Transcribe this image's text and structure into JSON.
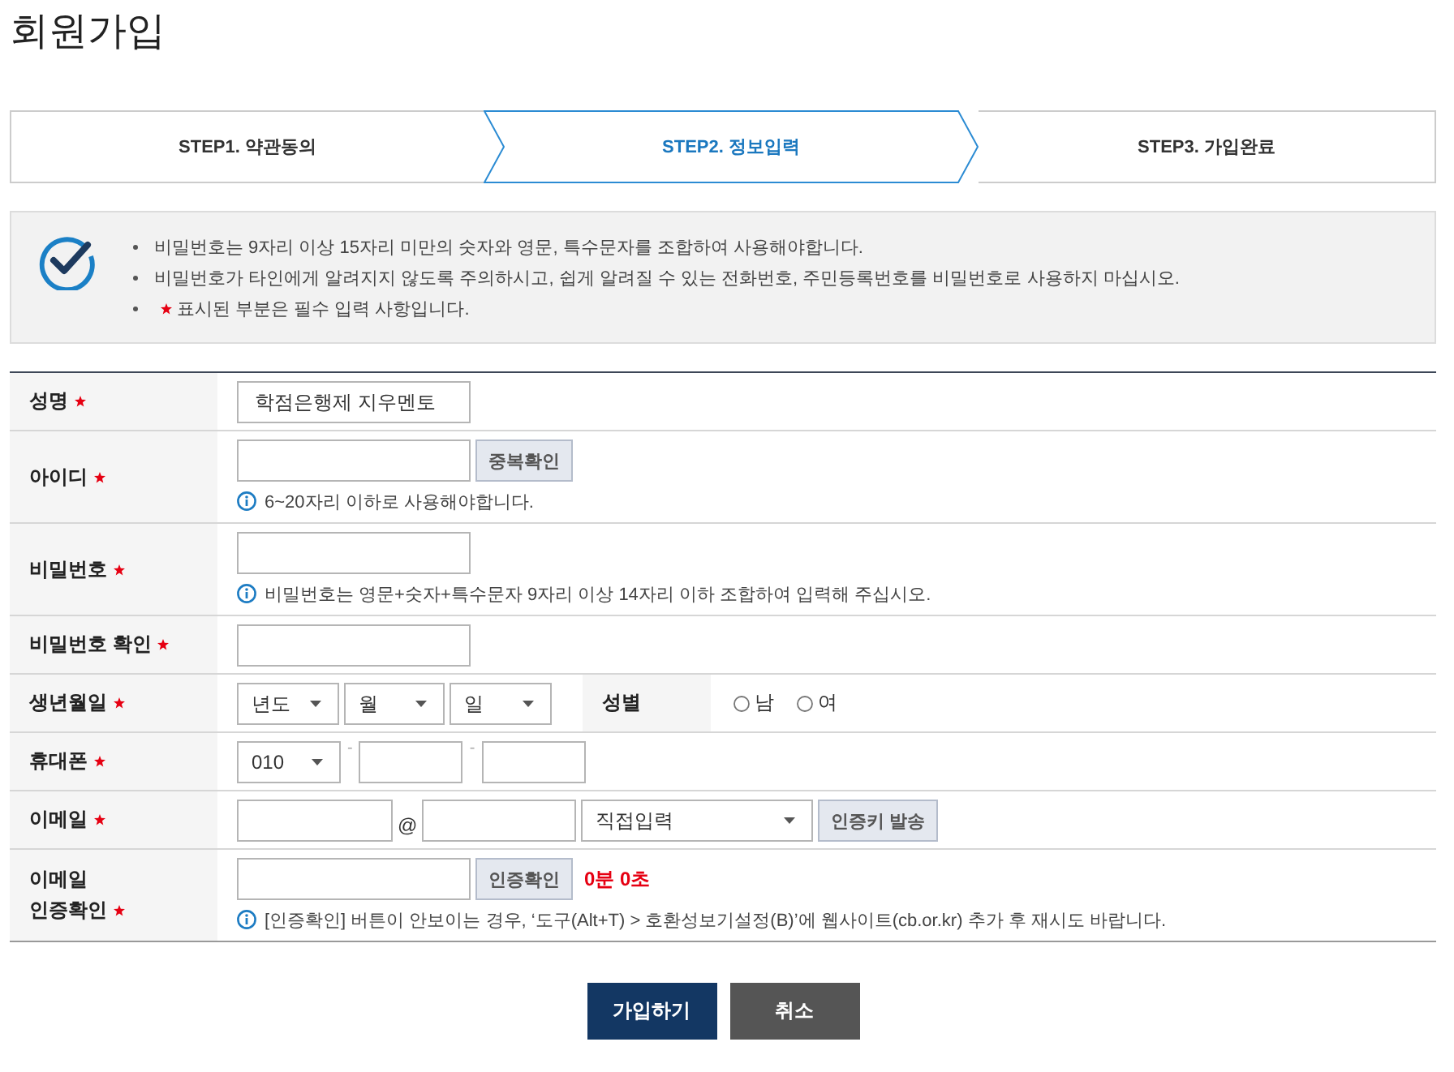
{
  "page_title": "회원가입",
  "steps": [
    {
      "label": "STEP1. 약관동의",
      "selected": false
    },
    {
      "label": "STEP2. 정보입력",
      "selected": true
    },
    {
      "label": "STEP3. 가입완료",
      "selected": false
    }
  ],
  "notice": {
    "items": [
      {
        "text": "비밀번호는 9자리 이상 15자리 미만의 숫자와 영문, 특수문자를 조합하여 사용해야합니다.",
        "required": false
      },
      {
        "text": "비밀번호가 타인에게 알려지지 않도록 주의하시고, 쉽게 알려질 수 있는 전화번호, 주민등록번호를 비밀번호로 사용하지 마십시오.",
        "required": false
      },
      {
        "text": "표시된 부분은 필수 입력 사항입니다.",
        "required": true
      }
    ]
  },
  "form": {
    "rows": [
      {
        "kind": "name",
        "label": "성명",
        "required": true,
        "controls": [
          {
            "kind": "input",
            "value": "학점은행제 지우멘토"
          }
        ]
      },
      {
        "kind": "id",
        "label": "아이디",
        "required": true,
        "controls": [
          {
            "kind": "input"
          },
          {
            "kind": "button",
            "label": "중복확인"
          }
        ],
        "hint": "6~20자리 이하로 사용해야합니다."
      },
      {
        "kind": "password",
        "label": "비밀번호",
        "required": true,
        "controls": [
          {
            "kind": "input"
          }
        ],
        "hint": "비밀번호는 영문+숫자+특수문자 9자리 이상 14자리 이하 조합하여 입력해 주십시오."
      },
      {
        "kind": "password_confirm",
        "label": "비밀번호 확인",
        "required": true,
        "controls": [
          {
            "kind": "input"
          }
        ]
      },
      {
        "kind": "birth",
        "label": "생년월일",
        "required": true,
        "controls": [
          {
            "kind": "select",
            "value": "년도"
          },
          {
            "kind": "select",
            "value": "월"
          },
          {
            "kind": "select",
            "value": "일"
          }
        ],
        "side": {
          "label": "성별",
          "options": [
            {
              "label": "남",
              "selected": false
            },
            {
              "label": "여",
              "selected": false
            }
          ]
        }
      },
      {
        "kind": "phone",
        "label": "휴대폰",
        "required": true,
        "controls": [
          {
            "kind": "select",
            "value": "010"
          },
          {
            "kind": "dash",
            "text": "-"
          },
          {
            "kind": "input"
          },
          {
            "kind": "dash",
            "text": "-"
          },
          {
            "kind": "input"
          }
        ]
      },
      {
        "kind": "email",
        "label": "이메일",
        "required": true,
        "controls": [
          {
            "kind": "input"
          },
          {
            "kind": "at",
            "text": "@"
          },
          {
            "kind": "input"
          },
          {
            "kind": "select",
            "value": "직접입력"
          },
          {
            "kind": "button",
            "label": "인증키 발송"
          }
        ]
      },
      {
        "kind": "email_verify",
        "label": "이메일\n인증확인",
        "required": true,
        "controls": [
          {
            "kind": "input"
          },
          {
            "kind": "button",
            "label": "인증확인"
          },
          {
            "kind": "timer",
            "text": "0분 0초"
          }
        ],
        "hint": "[인증확인] 버튼이 안보이는 경우, ‘도구(Alt+T) > 호환성보기설정(B)’에 웹사이트(cb.or.kr) 추가 후 재시도 바랍니다."
      }
    ]
  },
  "actions": [
    {
      "label": "가입하기",
      "kind": "primary"
    },
    {
      "label": "취소",
      "kind": "secondary"
    }
  ]
}
